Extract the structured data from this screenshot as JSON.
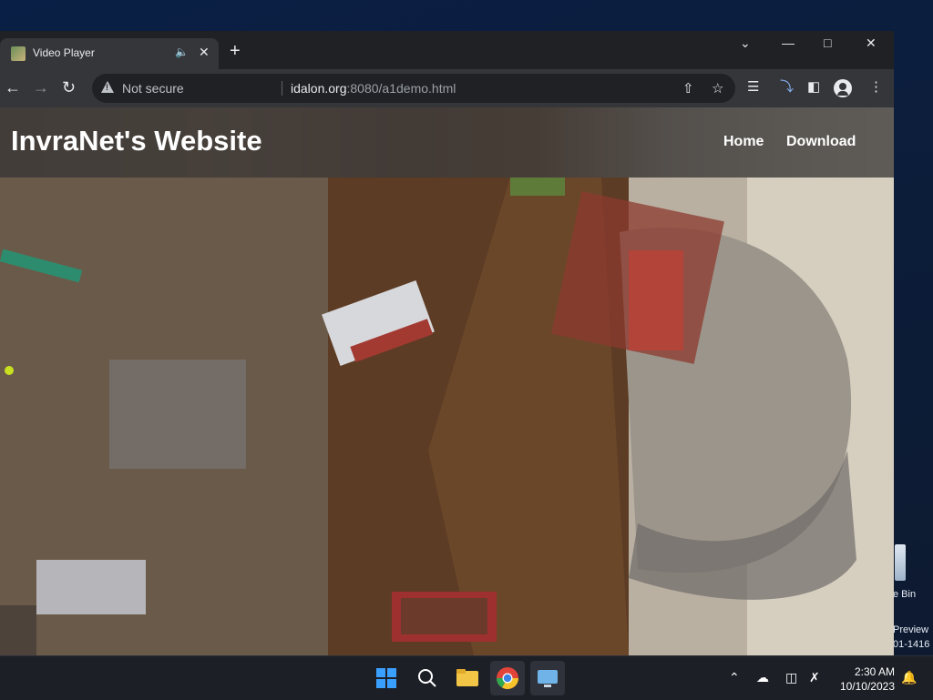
{
  "browser": {
    "tab_title": "Video Player",
    "new_tab_label": "+",
    "omnibox": {
      "security_label": "Not secure",
      "url_host": "idalon.org",
      "url_rest": ":8080/a1demo.html"
    }
  },
  "site": {
    "title": "InvraNet's Website",
    "nav": [
      "Home",
      "Download"
    ]
  },
  "desktop": {
    "recycle_bin_label": "e Bin",
    "preview_line1": "Preview",
    "preview_line2": "01-1416"
  },
  "taskbar": {
    "time": "2:30 AM",
    "date": "10/10/2023"
  },
  "colors": {
    "chrome_bg": "#202124",
    "toolbar_bg": "#35363a",
    "taskbar_bg": "#1c1f26",
    "site_header_overlay": "#3c3a38"
  }
}
